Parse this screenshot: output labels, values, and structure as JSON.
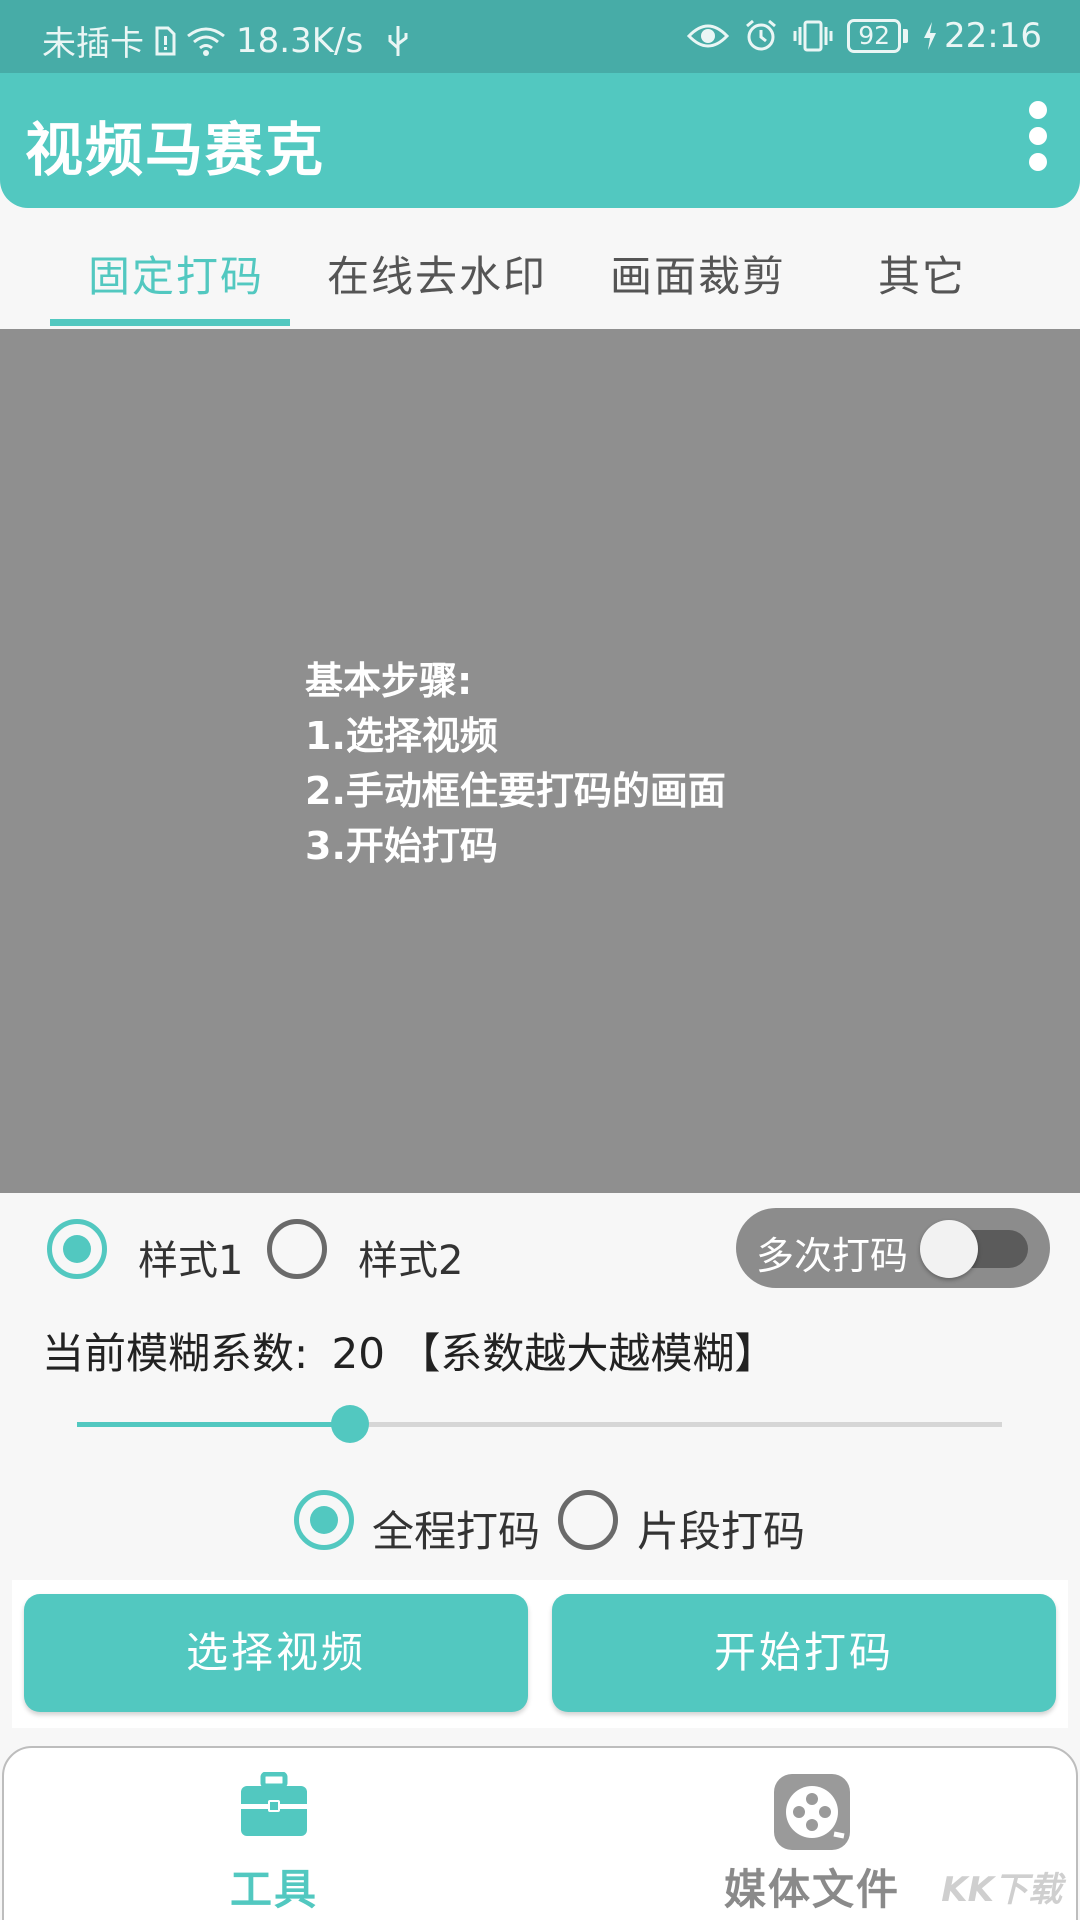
{
  "status_bar": {
    "carrier": "未插卡",
    "speed": "18.3K/s",
    "battery": "92",
    "time": "22:16"
  },
  "app_bar": {
    "title": "视频马赛克"
  },
  "tabs": [
    {
      "label": "固定打码",
      "active": true
    },
    {
      "label": "在线去水印",
      "active": false
    },
    {
      "label": "画面裁剪",
      "active": false
    },
    {
      "label": "其它",
      "active": false
    }
  ],
  "preview": {
    "steps": [
      "基本步骤:",
      "1.选择视频",
      "2.手动框住要打码的画面",
      "3.开始打码"
    ]
  },
  "style_options": [
    {
      "label": "样式1",
      "selected": true
    },
    {
      "label": "样式2",
      "selected": false
    }
  ],
  "multi_mask": {
    "label": "多次打码",
    "enabled": false
  },
  "blur": {
    "label": "当前模糊系数:",
    "value": "20",
    "hint": "【系数越大越模糊】",
    "slider_fraction": 0.295
  },
  "range_options": [
    {
      "label": "全程打码",
      "selected": true
    },
    {
      "label": "片段打码",
      "selected": false
    }
  ],
  "buttons": {
    "select_video": "选择视频",
    "start_mask": "开始打码"
  },
  "bottom_nav": [
    {
      "label": "工具",
      "icon": "toolbox-icon",
      "active": true
    },
    {
      "label": "媒体文件",
      "icon": "film-reel-icon",
      "active": false
    }
  ],
  "watermark": "KK下载",
  "colors": {
    "accent": "#52c8c0",
    "status_bar": "#47aca7",
    "preview_bg": "#8f8f8f",
    "inactive_nav": "#8a8a8a"
  }
}
